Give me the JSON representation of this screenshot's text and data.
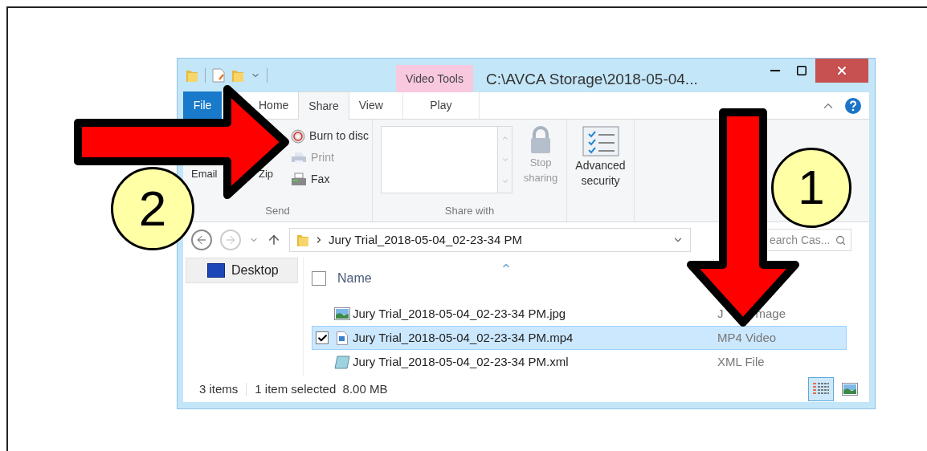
{
  "title_bar": {
    "contextual_tab": "Video Tools",
    "title": "C:\\AVCA Storage\\2018-05-04..."
  },
  "ribbon_tabs": [
    {
      "label": "File",
      "kind": "file",
      "selected": false
    },
    {
      "label": "Home",
      "kind": "tab",
      "selected": false
    },
    {
      "label": "Share",
      "kind": "tab",
      "selected": true
    },
    {
      "label": "View",
      "kind": "tab",
      "selected": false
    },
    {
      "label": "Play",
      "kind": "contextual",
      "selected": false
    }
  ],
  "send_group": {
    "label": "Send",
    "large": [
      {
        "label": "Email"
      },
      {
        "label": "Zip"
      }
    ],
    "small": [
      {
        "label": "Burn to disc",
        "kind": "disc",
        "disabled": false
      },
      {
        "label": "Print",
        "kind": "printer",
        "disabled": true
      },
      {
        "label": "Fax",
        "kind": "fax",
        "disabled": false
      }
    ]
  },
  "share_with_group": {
    "label": "Share with",
    "stop_sharing": {
      "label": "Stop sharing",
      "disabled": true
    }
  },
  "advanced_security": {
    "label": "Advanced security"
  },
  "address_bar": {
    "path": "Jury Trial_2018-05-04_02-23-34 PM"
  },
  "search": {
    "placeholder": "earch Cas..."
  },
  "nav_pane": [
    {
      "label": "Desktop",
      "selected": true
    }
  ],
  "file_list": {
    "select_all": {
      "checked": false
    },
    "columns": [
      {
        "label": "Name"
      }
    ],
    "rows": [
      {
        "name": "Jury Trial_2018-05-04_02-23-34 PM.jpg",
        "type": [
          "J",
          "mage"
        ],
        "kind": "image",
        "selected": false
      },
      {
        "name": "Jury Trial_2018-05-04_02-23-34 PM.mp4",
        "type": [
          "MP4 Video"
        ],
        "kind": "video",
        "selected": true
      },
      {
        "name": "Jury Trial_2018-05-04_02-23-34 PM.xml",
        "type": [
          "XML File"
        ],
        "kind": "xml",
        "selected": false
      }
    ]
  },
  "status_bar": {
    "count": "3 items",
    "selection": "1 item selected  8.00 MB"
  },
  "views": [
    {
      "kind": "details",
      "selected": true
    },
    {
      "kind": "thumbnails",
      "selected": false
    }
  ],
  "annotations": [
    {
      "number": "2",
      "kind": "right-arrow"
    },
    {
      "number": "1",
      "kind": "down-arrow"
    }
  ]
}
